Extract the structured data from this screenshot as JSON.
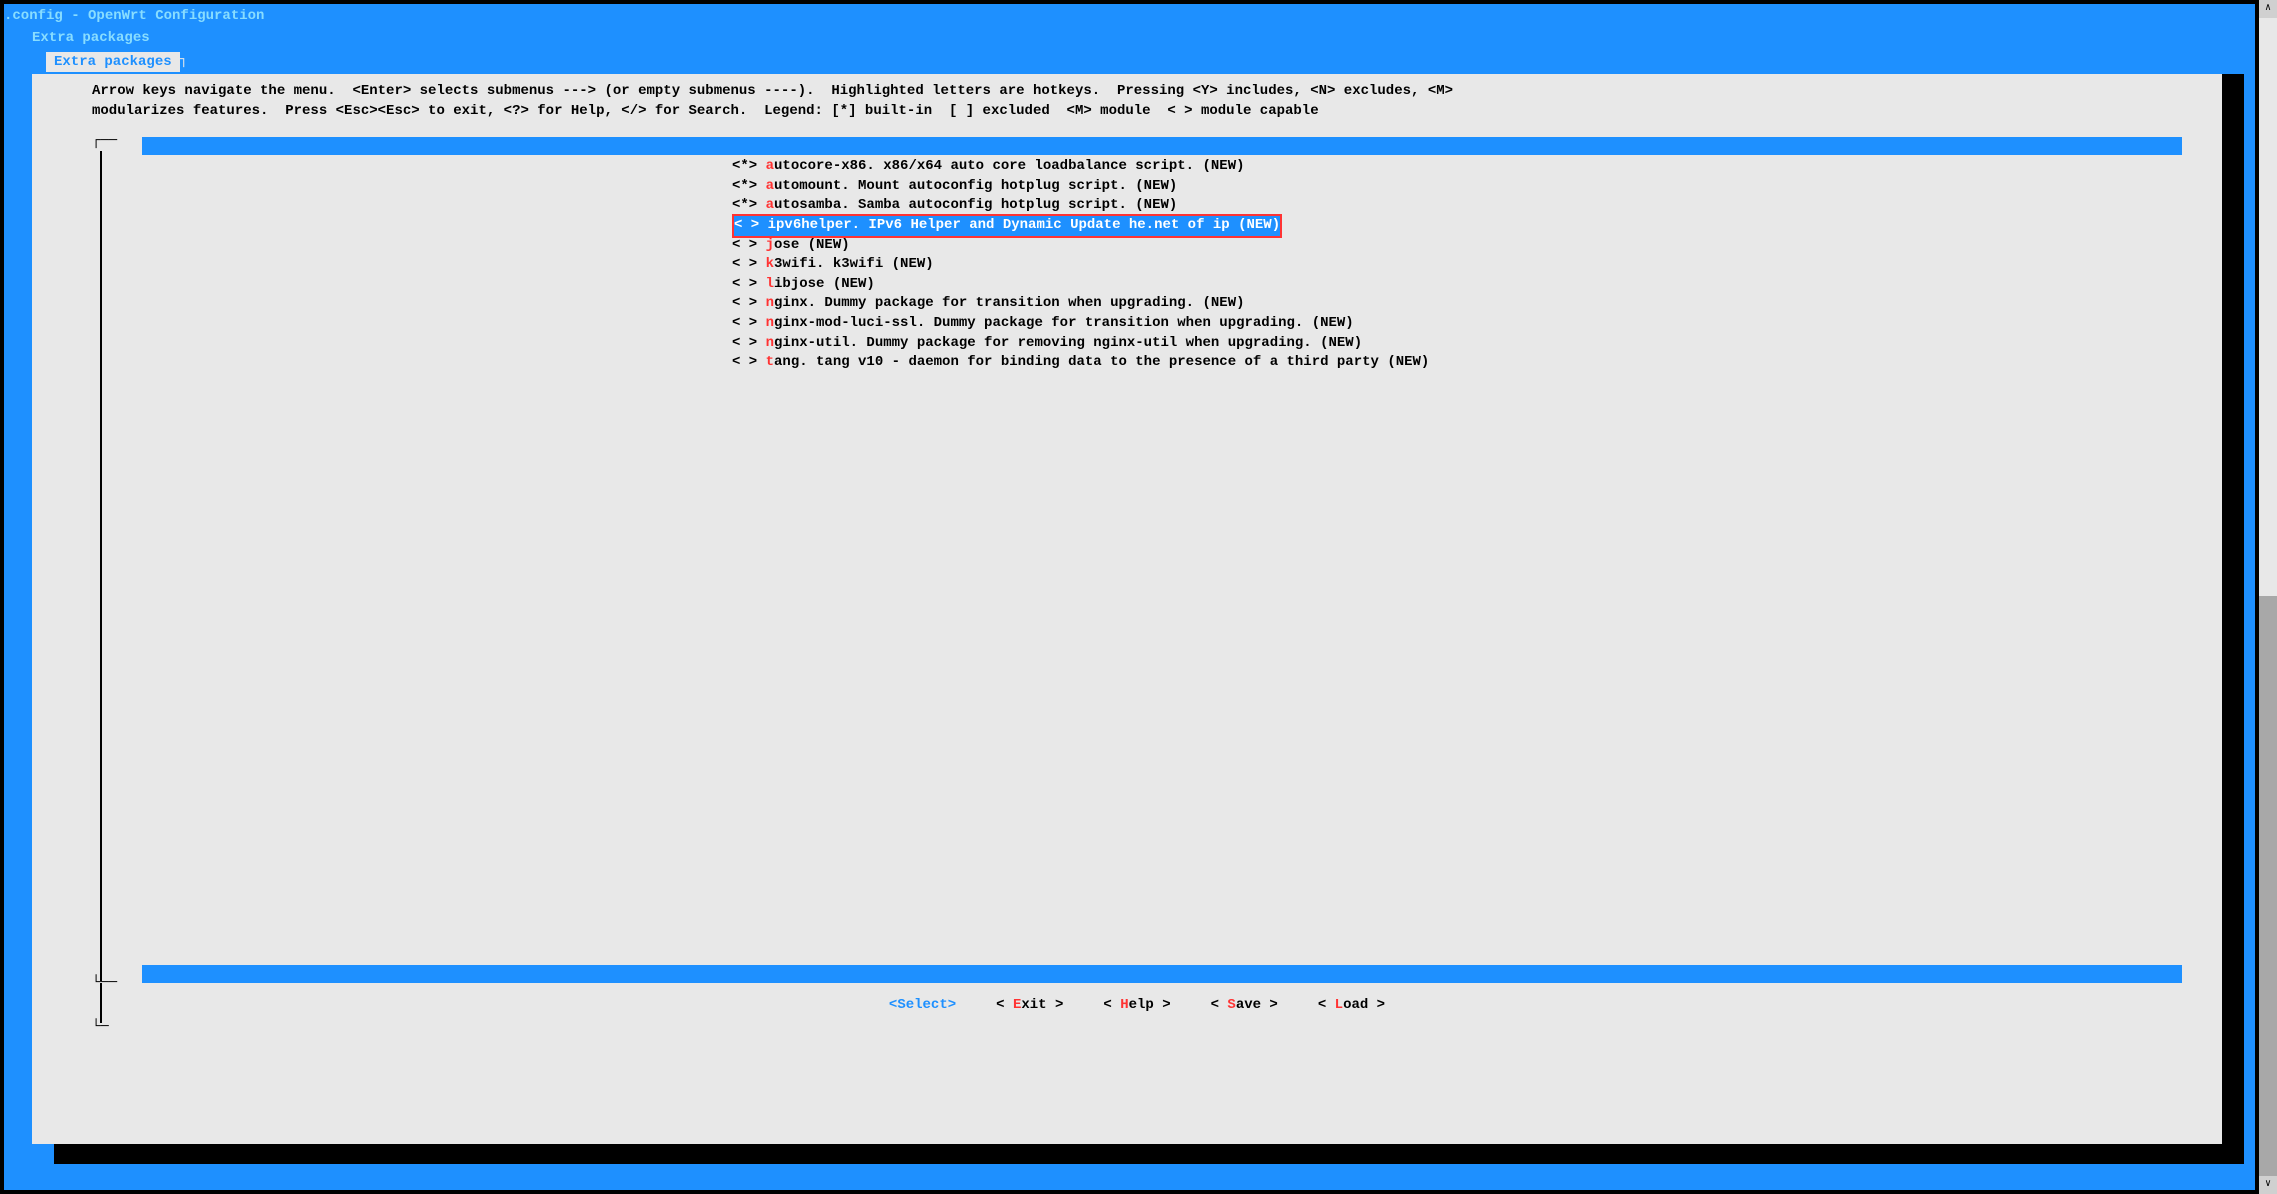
{
  "title": ".config - OpenWrt Configuration",
  "breadcrumb": "Extra packages",
  "tab": "Extra packages",
  "help_line1": "Arrow keys navigate the menu.  <Enter> selects submenus ---> (or empty submenus ----).  Highlighted letters are hotkeys.  Pressing <Y> includes, <N> excludes, <M>",
  "help_line2": "modularizes features.  Press <Esc><Esc> to exit, <?> for Help, </> for Search.  Legend: [*] built-in  [ ] excluded  <M> module  < > module capable",
  "items": [
    {
      "mark": "<*>",
      "hotkey": "a",
      "rest": "utocore-x86. x86/x64 auto core loadbalance script. (NEW)",
      "selected": false
    },
    {
      "mark": "<*>",
      "hotkey": "a",
      "rest": "utomount. Mount autoconfig hotplug script. (NEW)",
      "selected": false
    },
    {
      "mark": "<*>",
      "hotkey": "a",
      "rest": "utosamba. Samba autoconfig hotplug script. (NEW)",
      "selected": false
    },
    {
      "mark": "< >",
      "hotkey": "i",
      "rest": "pv6helper. IPv6 Helper and Dynamic Update he.net of ip (NEW)",
      "selected": true
    },
    {
      "mark": "< >",
      "hotkey": "j",
      "rest": "ose (NEW)",
      "selected": false
    },
    {
      "mark": "< >",
      "hotkey": "k",
      "rest": "3wifi. k3wifi (NEW)",
      "selected": false
    },
    {
      "mark": "< >",
      "hotkey": "l",
      "rest": "ibjose (NEW)",
      "selected": false
    },
    {
      "mark": "< >",
      "hotkey": "n",
      "rest": "ginx. Dummy package for transition when upgrading. (NEW)",
      "selected": false
    },
    {
      "mark": "< >",
      "hotkey": "n",
      "rest": "ginx-mod-luci-ssl. Dummy package for transition when upgrading. (NEW)",
      "selected": false
    },
    {
      "mark": "< >",
      "hotkey": "n",
      "rest": "ginx-util. Dummy package for removing nginx-util when upgrading. (NEW)",
      "selected": false
    },
    {
      "mark": "< >",
      "hotkey": "t",
      "rest": "ang. tang v10 - daemon for binding data to the presence of a third party (NEW)",
      "selected": false
    }
  ],
  "buttons": [
    {
      "pre": "<",
      "hotkey": "S",
      "post": "elect>",
      "selected": true
    },
    {
      "pre": "< ",
      "hotkey": "E",
      "post": "xit >",
      "selected": false
    },
    {
      "pre": "< ",
      "hotkey": "H",
      "post": "elp >",
      "selected": false
    },
    {
      "pre": "< ",
      "hotkey": "S",
      "post": "ave >",
      "selected": false
    },
    {
      "pre": "< ",
      "hotkey": "L",
      "post": "oad >",
      "selected": false
    }
  ]
}
